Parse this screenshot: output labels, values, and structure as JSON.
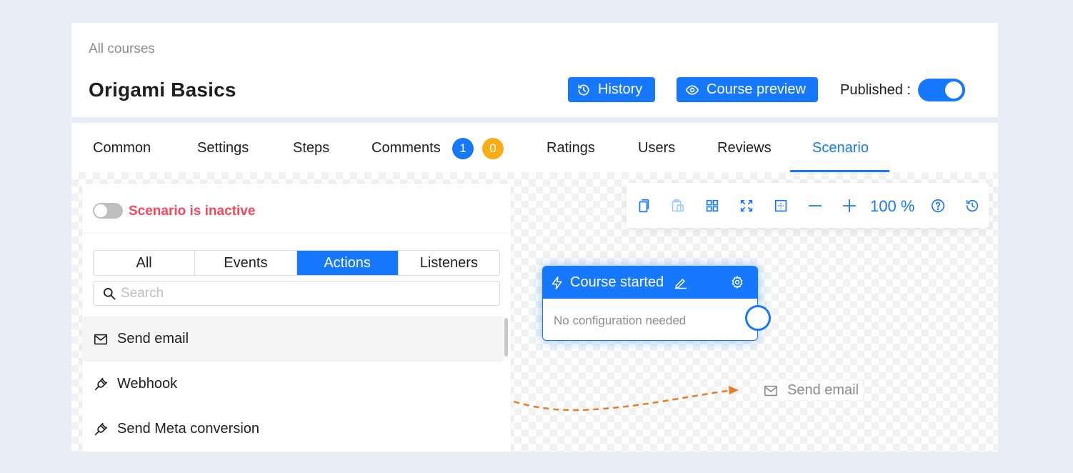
{
  "header": {
    "breadcrumb": "All courses",
    "title": "Origami Basics",
    "history_label": "History",
    "preview_label": "Course preview",
    "published_label": "Published :"
  },
  "tabs": {
    "common": "Common",
    "settings": "Settings",
    "steps": "Steps",
    "comments": "Comments",
    "comments_count_blue": "1",
    "comments_count_orange": "0",
    "ratings": "Ratings",
    "users": "Users",
    "reviews": "Reviews",
    "scenario": "Scenario"
  },
  "panel": {
    "status": "Scenario is inactive",
    "filters": {
      "all": "All",
      "events": "Events",
      "actions": "Actions",
      "listeners": "Listeners"
    },
    "search_placeholder": "Search",
    "items": [
      {
        "label": "Send email",
        "icon": "mail-icon"
      },
      {
        "label": "Webhook",
        "icon": "plug-icon"
      },
      {
        "label": "Send Meta conversion",
        "icon": "plug-icon"
      }
    ]
  },
  "toolbar": {
    "zoom": "100 %"
  },
  "node": {
    "title": "Course started",
    "body": "No configuration needed"
  },
  "drag_ghost": {
    "label": "Send email"
  },
  "colors": {
    "accent": "#1677ff",
    "danger": "#f5475c",
    "warning": "#faad14",
    "drag_path": "#e57e25"
  }
}
